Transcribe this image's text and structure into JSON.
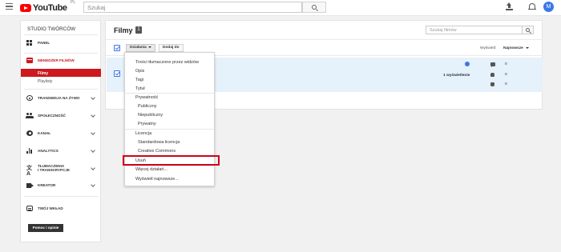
{
  "header": {
    "logo_text": "YouTube",
    "logo_region": "PL",
    "search_placeholder": "Szukaj",
    "avatar_letter": "M"
  },
  "sidebar": {
    "title": "STUDIO TWÓRCÓW",
    "items": [
      {
        "label": "PANEL",
        "icon": "dashboard-icon"
      },
      {
        "label": "MENEDŻER FILMÓW",
        "icon": "video-manager-icon"
      },
      {
        "label": "TRANSMISJA NA ŻYWO",
        "icon": "live-icon"
      },
      {
        "label": "SPOŁECZNOŚĆ",
        "icon": "community-icon"
      },
      {
        "label": "KANAŁ",
        "icon": "channel-icon"
      },
      {
        "label": "ANALYTICS",
        "icon": "analytics-icon"
      },
      {
        "label_line1": "TŁUMACZENIA",
        "label_line2": "I TRANSKRYPCJE",
        "icon": "translate-icon"
      },
      {
        "label": "KREATOR",
        "icon": "create-icon"
      },
      {
        "label": "TWÓJ WKŁAD",
        "icon": "contributions-icon"
      }
    ],
    "subitems": [
      {
        "label": "Filmy",
        "active": true
      },
      {
        "label": "Playlisty",
        "active": false
      }
    ],
    "help_button": "Pomoc i opinie"
  },
  "main": {
    "title": "Filmy",
    "count": "1",
    "filter_placeholder": "Szukaj filmów",
    "actions_button": "Działania",
    "add_to_button": "Dodaj do",
    "sort_label": "Wyświetl:",
    "sort_value": "Najnowsze",
    "video": {
      "views": "1 wyświetlenie",
      "comments": "0",
      "likes": "0",
      "dislikes": "0"
    }
  },
  "menu": {
    "top_items": [
      "Treści tłumaczone przez widzów",
      "Opis",
      "Tagi",
      "Tytuł"
    ],
    "privacy_header": "Prywatność",
    "privacy_items": [
      "Publiczny",
      "Niepubliczny",
      "Prywatny"
    ],
    "license_header": "Licencja",
    "license_items": [
      "Standardowa licencja",
      "Creative Commons"
    ],
    "delete_item": "Usuń",
    "more_items": [
      "Więcej działań...",
      "Wyświetl najnowsze..."
    ]
  },
  "colors": {
    "accent_red": "#cc181e",
    "selection_blue": "#3b78e7",
    "highlight_border": "#d0021b",
    "row_highlight": "#e5f1fb"
  }
}
